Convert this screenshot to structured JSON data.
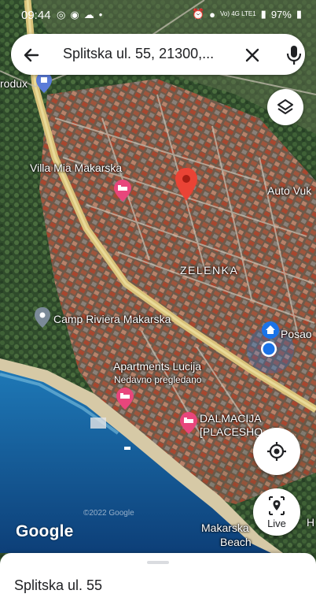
{
  "status_bar": {
    "time": "09:44",
    "battery": "97%",
    "network": "Vo) 4G LTE1"
  },
  "search": {
    "query": "Splitska ul. 55, 21300,..."
  },
  "map": {
    "labels": {
      "prodex": "rodux",
      "villa": "Villa Mia Makarska",
      "auto": "Auto Vuk",
      "zelenka": "ZELENKA",
      "camp": "Camp Riviera Makarska",
      "posao": "Posao",
      "apartments": "Apartments Lucija",
      "recent": "Nedavno pregledano",
      "dalmacija_1": "DALMACIJA",
      "dalmacija_2": "[PLACESHO... by...",
      "makarska_1": "Makarska",
      "makarska_2": "Beach",
      "h": "H"
    },
    "copyright": "©2022 Google",
    "logo": "Google"
  },
  "controls": {
    "live_label": "Live"
  },
  "bottom_sheet": {
    "place_name": "Splitska ul. 55"
  },
  "icons": [
    "back-arrow-icon",
    "clear-icon",
    "mic-icon",
    "layers-icon",
    "locate-icon",
    "live-view-icon",
    "hotel-icon",
    "place-pin-icon",
    "home-icon"
  ],
  "colors": {
    "pin_red": "#ea4335",
    "hotel_pink": "#e8467c",
    "location_blue": "#1a73e8",
    "road_yellow": "#d9c27a"
  }
}
